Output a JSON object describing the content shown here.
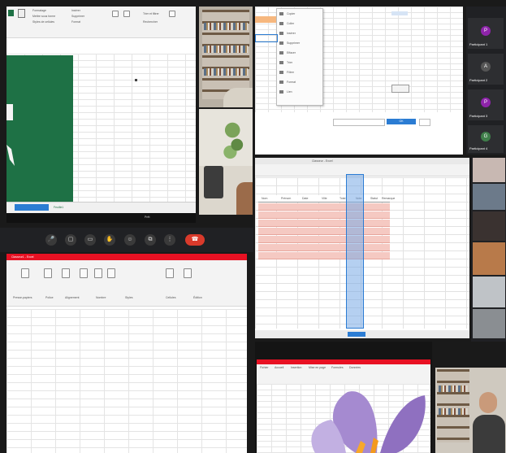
{
  "colors": {
    "excel_green": "#1e7145",
    "accent_blue": "#2b7cd3",
    "hangup_red": "#d93a2b",
    "pink_cells": "#f5c9c2",
    "flower_purple": "#9b7cc8"
  },
  "tiles": {
    "top_left": {
      "ribbon_items": [
        "Formatage",
        "Mettre sous forme",
        "Styles de cellules",
        "Insérer",
        "Supprimer",
        "Format",
        "Trier et filtrer",
        "Rechercher"
      ],
      "sheet_tab_label": "Feuille1",
      "status_label": "Prêt"
    },
    "top_right": {
      "menu_items": [
        "Copier",
        "Coller",
        "Insérer",
        "Supprimer",
        "Effacer",
        "Trier",
        "Filtrer",
        "Format",
        "Lien"
      ],
      "dialog_placeholder": "",
      "dialog_button": "OK"
    },
    "participants": [
      {
        "initial": "P",
        "name": "Participant 1"
      },
      {
        "initial": "A",
        "name": "Participant 2"
      },
      {
        "initial": "P",
        "name": "Participant 3"
      },
      {
        "initial": "G",
        "name": "Participant 4"
      }
    ],
    "mid_right_sheet": {
      "title": "Classeur - Excel",
      "headers": [
        "Nom",
        "Prénom",
        "Date",
        "Ville",
        "Total",
        "Note",
        "Statut",
        "Remarque"
      ]
    },
    "bottom_left": {
      "title_bar": "Classeur1 - Excel",
      "ribbon_groups": [
        "Presse-papiers",
        "Police",
        "Alignement",
        "Nombre",
        "Styles",
        "Cellules",
        "Édition"
      ]
    },
    "bottom_right_sheet": {
      "menu": [
        "Fichier",
        "Accueil",
        "Insertion",
        "Mise en page",
        "Formules",
        "Données"
      ]
    }
  },
  "meeting_controls": [
    {
      "icon": "mic-icon",
      "glyph": "🎤"
    },
    {
      "icon": "camera-icon",
      "glyph": "▢"
    },
    {
      "icon": "share-screen-icon",
      "glyph": "▭"
    },
    {
      "icon": "hand-icon",
      "glyph": "✋"
    },
    {
      "icon": "reactions-icon",
      "glyph": "☺"
    },
    {
      "icon": "captions-icon",
      "glyph": "⧉"
    },
    {
      "icon": "more-icon",
      "glyph": "⋮"
    },
    {
      "icon": "hangup-icon",
      "glyph": "☎"
    }
  ]
}
